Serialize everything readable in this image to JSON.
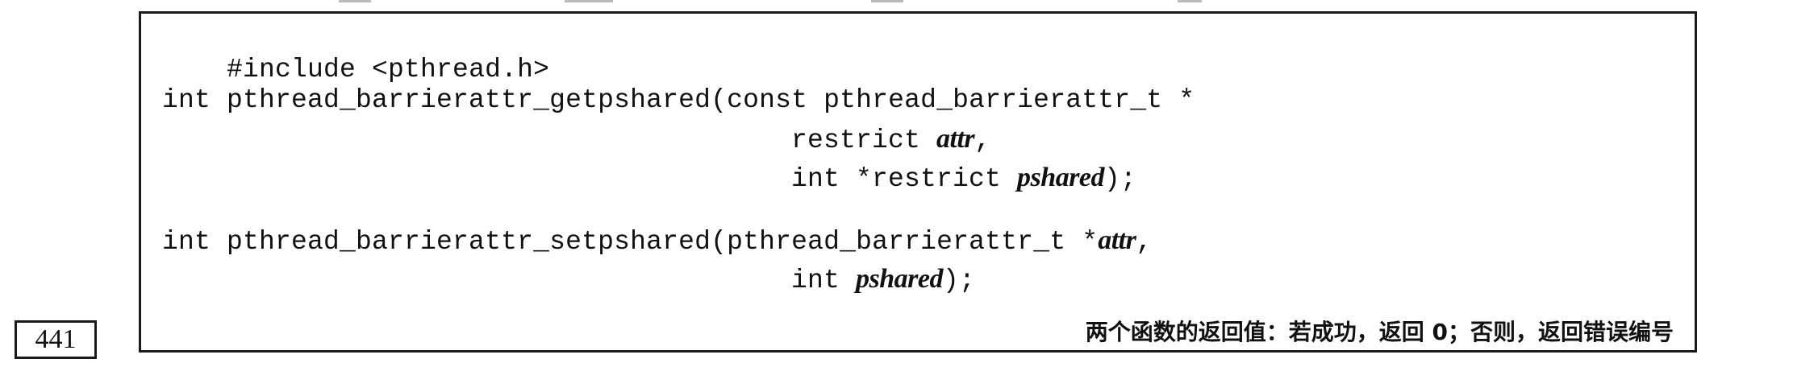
{
  "prototype": {
    "include_line": "#include <pthread.h>",
    "getpshared": {
      "prefix": "int pthread_barrierattr_getpshared(",
      "first_param_type": "const pthread_barrierattr_t *",
      "line2_prefix": "restrict ",
      "attr_name": "attr",
      "line2_suffix": ",",
      "line3_prefix": "int *restrict ",
      "pshared_name": "pshared",
      "line3_suffix": ");"
    },
    "setpshared": {
      "prefix": "int pthread_barrierattr_setpshared(",
      "first_param_type": "pthread_barrierattr_t *",
      "attr_name": "attr",
      "line1_suffix": ",",
      "line2_prefix": "int ",
      "pshared_name": "pshared",
      "line2_suffix": ");"
    },
    "return_note": "两个函数的返回值：若成功，返回 0；否则，返回错误编号"
  },
  "page_number": "441"
}
